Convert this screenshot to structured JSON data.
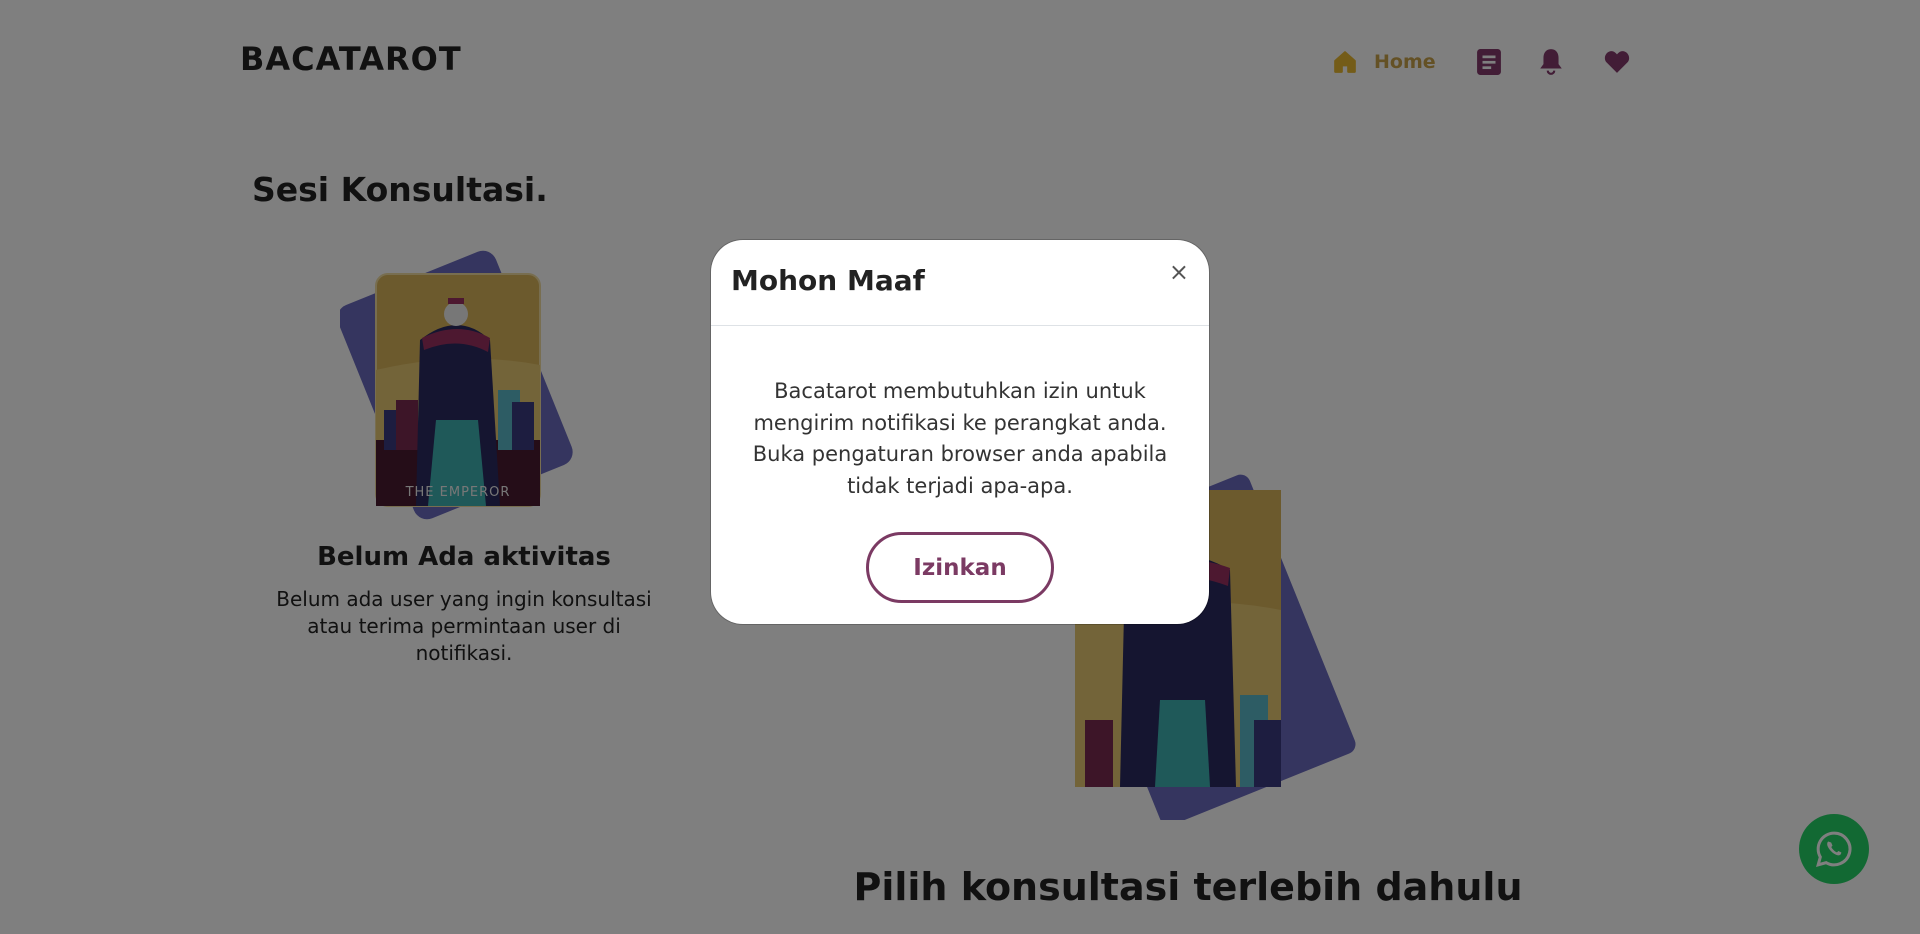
{
  "header": {
    "brand": "BACATAROT",
    "nav": {
      "home_label": "Home",
      "icons": [
        "home-icon",
        "document-icon",
        "bell-icon",
        "heart-icon"
      ]
    }
  },
  "colors": {
    "accent": "#7b3a63",
    "home_active": "#c9a24b",
    "whatsapp": "#25d366",
    "card_back": "#6a6abe",
    "card_gold": "#d9b45a"
  },
  "main": {
    "section_title": "Sesi Konsultasi.",
    "empty_state": {
      "card_label": "THE EMPEROR",
      "title": "Belum Ada aktivitas",
      "description": "Belum ada user yang ingin konsultasi atau terima permintaan user di notifikasi."
    },
    "right_panel": {
      "title": "Pilih konsultasi terlebih dahulu"
    }
  },
  "modal": {
    "title": "Mohon Maaf",
    "close_label": "×",
    "message": "Bacatarot membutuhkan izin untuk mengirim notifikasi ke perangkat anda. Buka pengaturan browser anda apabila tidak terjadi apa-apa.",
    "confirm_label": "Izinkan"
  },
  "floating": {
    "icon": "whatsapp-icon"
  }
}
